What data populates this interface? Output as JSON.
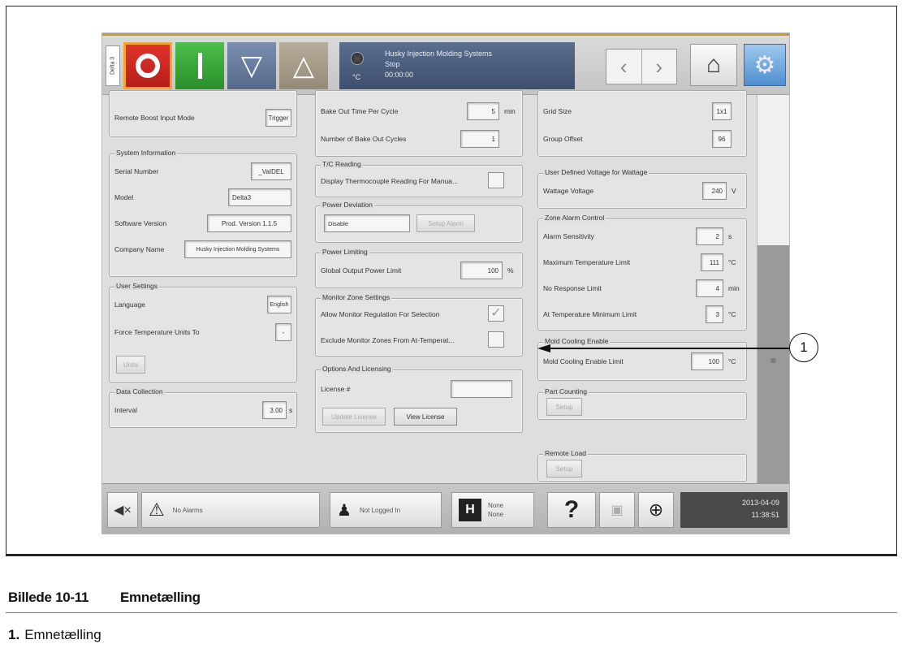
{
  "header": {
    "delta_tab": "Delta 3",
    "status_lines": [
      "Husky Injection Molding Systems",
      "Stop",
      "00:00:00"
    ],
    "status_unit": "°C"
  },
  "col1": {
    "boost_mode_label": "Remote Boost Input Mode",
    "boost_mode_value": "Trigger",
    "system_info": {
      "title": "System Information",
      "serial_label": "Serial Number",
      "serial_value": "_VaIDEL",
      "model_label": "Model",
      "model_value": "Delta3",
      "software_label": "Software Version",
      "software_value": "Prod. Version 1.1.5",
      "company_label": "Company Name",
      "company_value": "Husky Injection Molding Systems"
    },
    "user_settings": {
      "title": "User Settings",
      "language_label": "Language",
      "language_value": "English",
      "force_units_label": "Force Temperature Units To",
      "force_units_value": "-",
      "units_button": "Units"
    },
    "data_collection": {
      "title": "Data Collection",
      "interval_label": "Interval",
      "interval_value": "3.00",
      "interval_unit": "s"
    }
  },
  "col2": {
    "bake_time_label": "Bake Out Time Per Cycle",
    "bake_time_value": "5",
    "bake_time_unit": "min",
    "bake_cycles_label": "Number of Bake Out Cycles",
    "bake_cycles_value": "1",
    "tc_reading": {
      "title": "T/C Reading",
      "display_label": "Display Thermocouple Reading For Manua..."
    },
    "power_deviation": {
      "title": "Power Deviation",
      "select_value": "Disable",
      "setup_alarm": "Setup Alarm"
    },
    "power_limiting": {
      "title": "Power Limiting",
      "global_label": "Global Output Power Limit",
      "global_value": "100",
      "global_unit": "%"
    },
    "monitor_zone": {
      "title": "Monitor Zone Settings",
      "allow_label": "Allow Monitor Regulation For Selection",
      "exclude_label": "Exclude Monitor Zones From At-Temperat..."
    },
    "options_licensing": {
      "title": "Options And Licensing",
      "license_label": "License #",
      "update_button": "Update License",
      "view_button": "View License"
    }
  },
  "col3": {
    "grid_size_label": "Grid Size",
    "grid_size_value": "1x1",
    "group_offset_label": "Group Offset",
    "group_offset_value": "96",
    "user_voltage": {
      "title": "User Defined Voltage for Wattage",
      "wattage_label": "Wattage Voltage",
      "wattage_value": "240",
      "wattage_unit": "V"
    },
    "zone_alarm": {
      "title": "Zone Alarm Control",
      "sensitivity_label": "Alarm Sensitivity",
      "sensitivity_value": "2",
      "sensitivity_unit": "s",
      "max_temp_label": "Maximum Temperature Limit",
      "max_temp_value": "111",
      "max_temp_unit": "°C",
      "no_response_label": "No Response Limit",
      "no_response_value": "4",
      "no_response_unit": "min",
      "at_temp_label": "At Temperature Minimum Limit",
      "at_temp_value": "3",
      "at_temp_unit": "°C"
    },
    "mold_cooling": {
      "title": "Mold Cooling Enable",
      "limit_label": "Mold Cooling Enable Limit",
      "limit_value": "100",
      "limit_unit": "°C"
    },
    "part_counting": {
      "title": "Part Counting",
      "setup": "Setup"
    },
    "remote_load": {
      "title": "Remote Load",
      "setup": "Setup"
    }
  },
  "footer": {
    "alarms": "No Alarms",
    "login": "Not Logged In",
    "mold_line1": "None",
    "mold_line2": "None",
    "help": "?",
    "date": "2013-04-09",
    "time": "11:38:51"
  },
  "callout": {
    "number": "1"
  },
  "caption": {
    "figure_number": "Billede 10-11",
    "figure_title": "Emnetælling",
    "legend_number": "1.",
    "legend_text": "Emnetælling"
  },
  "icons": {
    "stop": "stop-icon",
    "power_on": "power-on-icon",
    "down": "triangle-down-icon",
    "up": "triangle-up-icon",
    "home": "home-icon",
    "settings": "gears-icon",
    "mute": "mute-icon",
    "alarm": "warning-icon",
    "user": "user-icon",
    "mold": "mold-icon",
    "globe": "globe-icon"
  },
  "colors": {
    "accent_orange": "#f4a62a",
    "stop_red": "#d22a22",
    "on_green": "#3aa83a",
    "status_panel": "#4d607e"
  }
}
